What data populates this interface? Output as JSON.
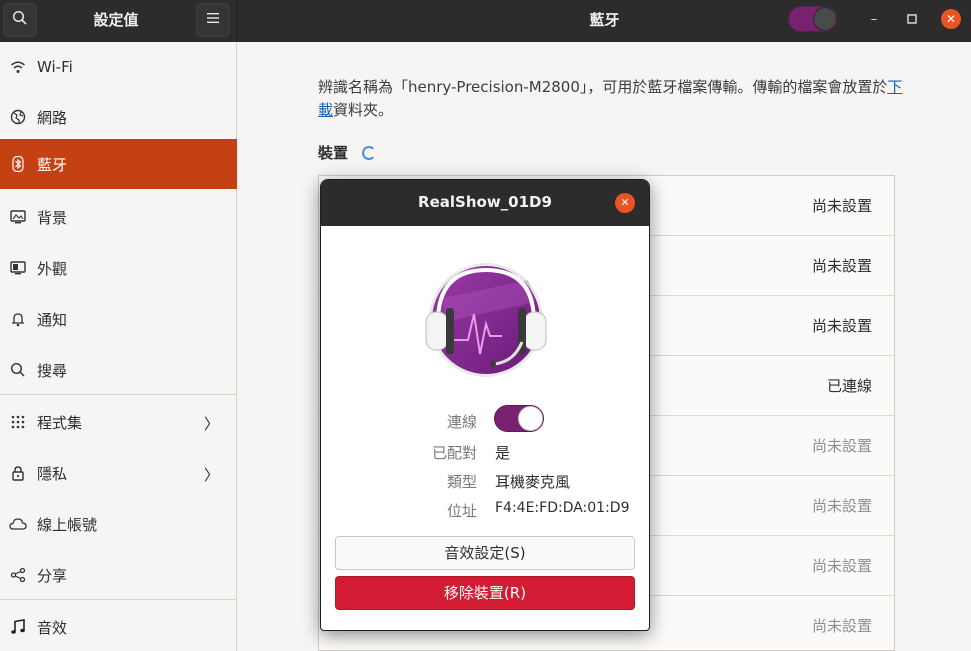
{
  "header": {
    "left_title": "設定值",
    "title": "藍牙",
    "search_icon": "search-icon",
    "menu_icon": "hamburger-menu-icon",
    "bluetooth_switch_on": true,
    "window_controls": {
      "minimize": "–",
      "maximize": "□",
      "close": "✕"
    }
  },
  "sidebar": {
    "items": [
      {
        "label": "Wi-Fi",
        "icon": "wifi-icon"
      },
      {
        "label": "網路",
        "icon": "network-globe-icon"
      },
      {
        "label": "藍牙",
        "icon": "bluetooth-icon",
        "active": true
      },
      {
        "label": "背景",
        "icon": "background-icon"
      },
      {
        "label": "外觀",
        "icon": "appearance-icon"
      },
      {
        "label": "通知",
        "icon": "bell-icon"
      },
      {
        "label": "搜尋",
        "icon": "search-icon"
      },
      {
        "label": "程式集",
        "icon": "apps-grid-icon",
        "chevron": "〉"
      },
      {
        "label": "隱私",
        "icon": "lock-icon",
        "chevron": "〉"
      },
      {
        "label": "線上帳號",
        "icon": "cloud-icon"
      },
      {
        "label": "分享",
        "icon": "share-icon"
      },
      {
        "label": "音效",
        "icon": "music-note-icon"
      }
    ]
  },
  "main": {
    "description_prefix": "辨識名稱為「henry-Precision-M2800」，可用於藍牙檔案傳輸。傳輸的檔案會放置於",
    "description_link": "下載",
    "description_suffix": "資料夾。",
    "devices_label": "裝置",
    "devices": [
      {
        "status": "尚未設置"
      },
      {
        "status": "尚未設置"
      },
      {
        "status": "尚未設置"
      },
      {
        "status": "已連線"
      },
      {
        "status": "尚未設置"
      },
      {
        "status": "尚未設置"
      },
      {
        "status": "尚未設置"
      },
      {
        "status": "尚未設置"
      }
    ]
  },
  "dialog": {
    "title": "RealShow_01D9",
    "close_label": "✕",
    "device_icon": "headset-icon",
    "connection_label": "連線",
    "connection_on": true,
    "paired_label": "已配對",
    "paired_value": "是",
    "type_label": "類型",
    "type_value": "耳機麥克風",
    "address_label": "位址",
    "address_value": "F4:4E:FD:DA:01:D9",
    "sound_settings_button": "音效設定(S)",
    "remove_device_button": "移除裝置(R)"
  },
  "colors": {
    "accent": "#77216f",
    "sidebar_active": "#c34113",
    "close_orange": "#e95420",
    "destructive": "#d31b33",
    "link": "#1a5fb4"
  }
}
